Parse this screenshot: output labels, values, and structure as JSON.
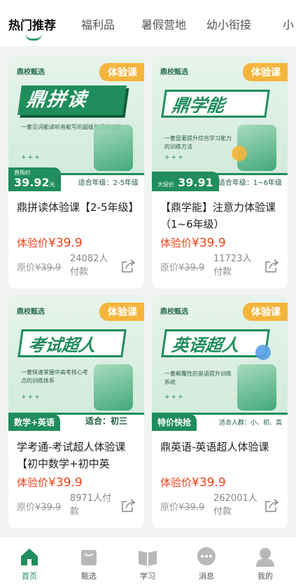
{
  "tabs": [
    {
      "label": "热门推荐",
      "active": true
    },
    {
      "label": "福利品"
    },
    {
      "label": "暑假营地"
    },
    {
      "label": "幼小衔接"
    },
    {
      "label": "小"
    }
  ],
  "cards": [
    {
      "brand": "鼎校甄选",
      "badge": "体验课",
      "headline": "鼎拼读",
      "subline": "一套见词能读听音能写的超级单词拼读法",
      "price_tag_label": "直购价",
      "price_tag_value": "39.92",
      "price_tag_unit": "元",
      "grade": "适合年级：2-5年级",
      "title": "鼎拼读体验课【2-5年级】",
      "exp_label": "体验价",
      "exp_price": "¥39.9",
      "orig_label": "原价",
      "orig_price": "¥39.9",
      "count": "24082人付款"
    },
    {
      "brand": "鼎校甄选",
      "badge": "体验课",
      "headline": "鼎学能",
      "subline": "一套显著提升综合学习能力的训练方法",
      "price_tag_label": "大促价",
      "price_tag_value": "39.91",
      "grade": "适合年级：1~6年级",
      "title": "【鼎学能】注意力体验课（1~6年级）",
      "exp_label": "体验价",
      "exp_price": "¥39.9",
      "orig_label": "原价",
      "orig_price": "¥39.9",
      "count": "11723人付款"
    },
    {
      "brand": "鼎校甄选",
      "badge": "体验课",
      "headline": "考试超人",
      "subline": "一套快速掌握中高考核心考点的训练体系",
      "green_tag": "数学+英语",
      "grade": "适合：初三",
      "title": "学考通-考试超人体验课【初中数学+初中英",
      "exp_label": "体验价",
      "exp_price": "¥39.9",
      "orig_label": "原价",
      "orig_price": "¥39.9",
      "count": "8971人付款"
    },
    {
      "brand": "鼎校甄选",
      "badge": "体验课",
      "headline": "英语超人",
      "subline": "一套颠覆性的英语提升训练系统",
      "green_tag": "特价快抢",
      "grade": "适合人群：小、初、高",
      "title": "鼎英语-英语超人体验课",
      "exp_label": "体验价",
      "exp_price": "¥39.9",
      "orig_label": "原价",
      "orig_price": "¥39.9",
      "count": "262001人付款"
    }
  ],
  "nav": [
    {
      "label": "首页",
      "icon": "home-icon",
      "active": true
    },
    {
      "label": "甄选",
      "icon": "bag-icon"
    },
    {
      "label": "学习",
      "icon": "book-icon"
    },
    {
      "label": "消息",
      "icon": "chat-icon"
    },
    {
      "label": "我的",
      "icon": "user-icon"
    }
  ],
  "colors": {
    "accent": "#1f8d5c",
    "price": "#f0421a",
    "badge": "#f5b53c"
  }
}
